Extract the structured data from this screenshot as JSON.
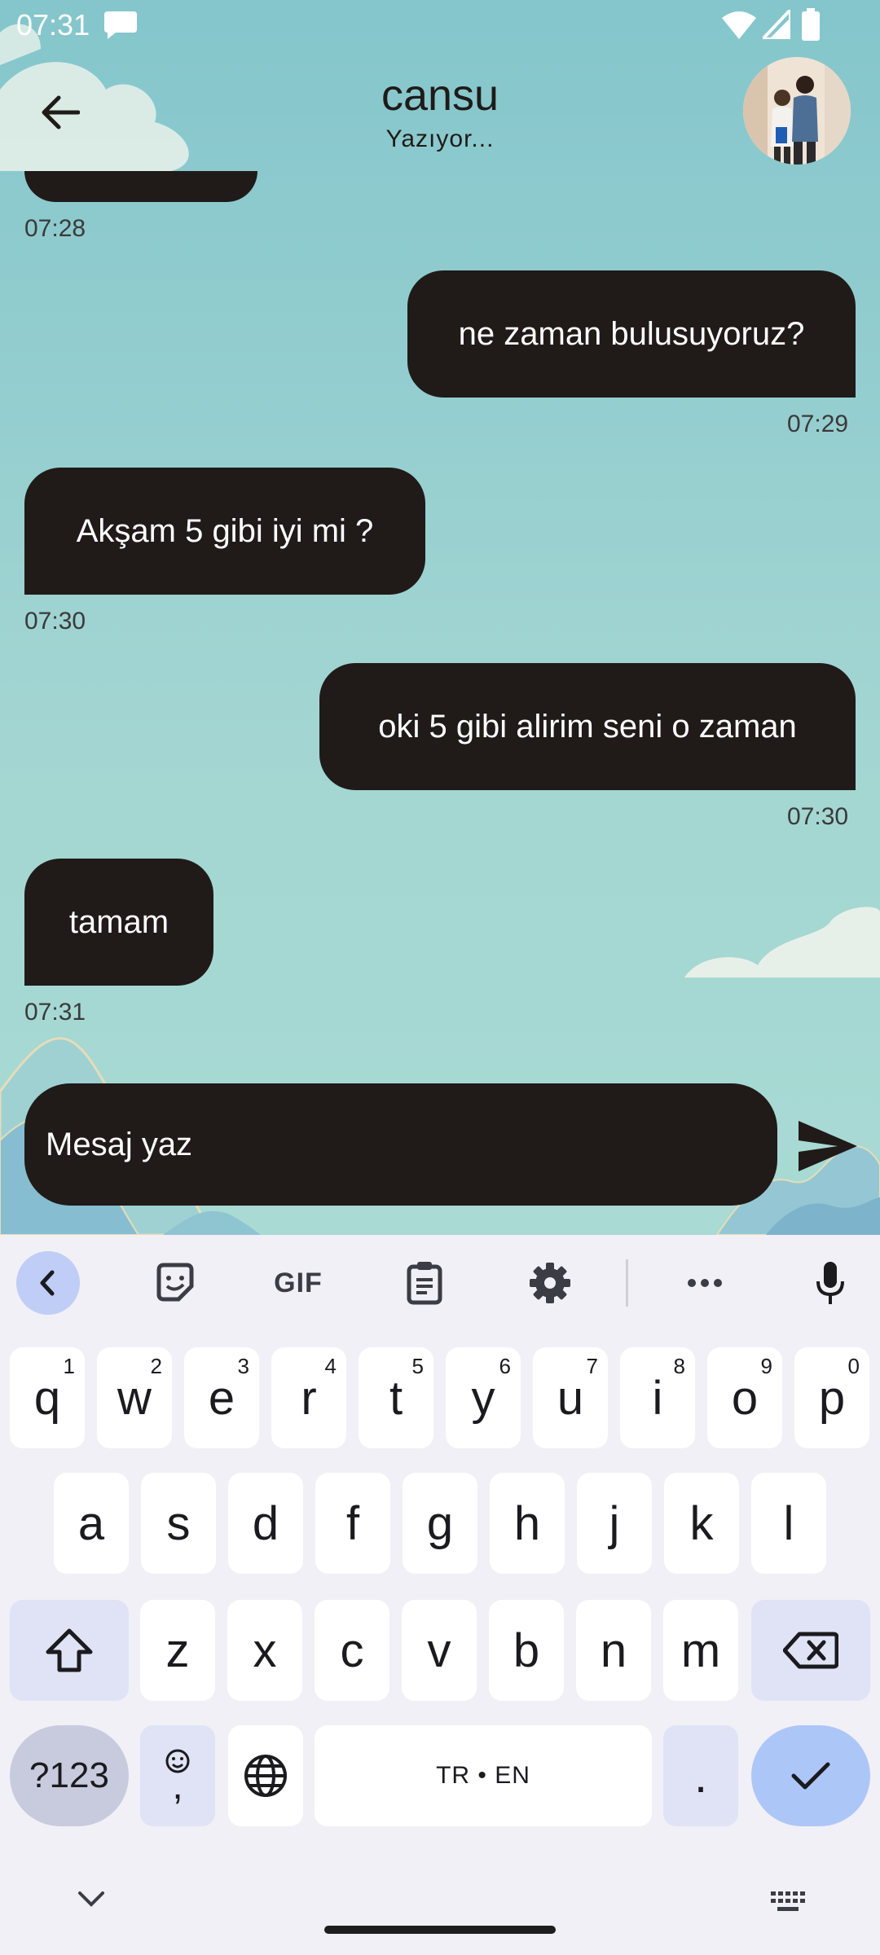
{
  "status_bar": {
    "time": "07:31"
  },
  "header": {
    "name": "cansu",
    "status": "Yazıyor..."
  },
  "messages": [
    {
      "text": "",
      "time": "07:28",
      "direction": "incoming"
    },
    {
      "text": "ne zaman bulusuyoruz?",
      "time": "07:29",
      "direction": "outgoing"
    },
    {
      "text": "Akşam 5 gibi iyi mi ?",
      "time": "07:30",
      "direction": "incoming"
    },
    {
      "text": "oki 5 gibi alirim seni o zaman",
      "time": "07:30",
      "direction": "outgoing"
    },
    {
      "text": "tamam",
      "time": "07:31",
      "direction": "incoming"
    }
  ],
  "compose": {
    "placeholder": "Mesaj yaz"
  },
  "keyboard": {
    "toolbar": [
      "chevron-left-icon",
      "sticker-icon",
      "GIF",
      "clipboard-icon",
      "gear-icon",
      "more-icon",
      "mic-icon"
    ],
    "gif_label": "GIF",
    "row1": [
      {
        "k": "q",
        "h": "1"
      },
      {
        "k": "w",
        "h": "2"
      },
      {
        "k": "e",
        "h": "3"
      },
      {
        "k": "r",
        "h": "4"
      },
      {
        "k": "t",
        "h": "5"
      },
      {
        "k": "y",
        "h": "6"
      },
      {
        "k": "u",
        "h": "7"
      },
      {
        "k": "i",
        "h": "8"
      },
      {
        "k": "o",
        "h": "9"
      },
      {
        "k": "p",
        "h": "0"
      }
    ],
    "row2": [
      "a",
      "s",
      "d",
      "f",
      "g",
      "h",
      "j",
      "k",
      "l"
    ],
    "row3": [
      "z",
      "x",
      "c",
      "v",
      "b",
      "n",
      "m"
    ],
    "symbols_label": "?123",
    "emoji_comma": ",",
    "space_label": "TR • EN",
    "period": ".",
    "colors": {
      "background": "#f1f0f6",
      "accent": "#adc6f8",
      "modifier": "#dfe3f5",
      "bubble": "#201b18"
    }
  }
}
